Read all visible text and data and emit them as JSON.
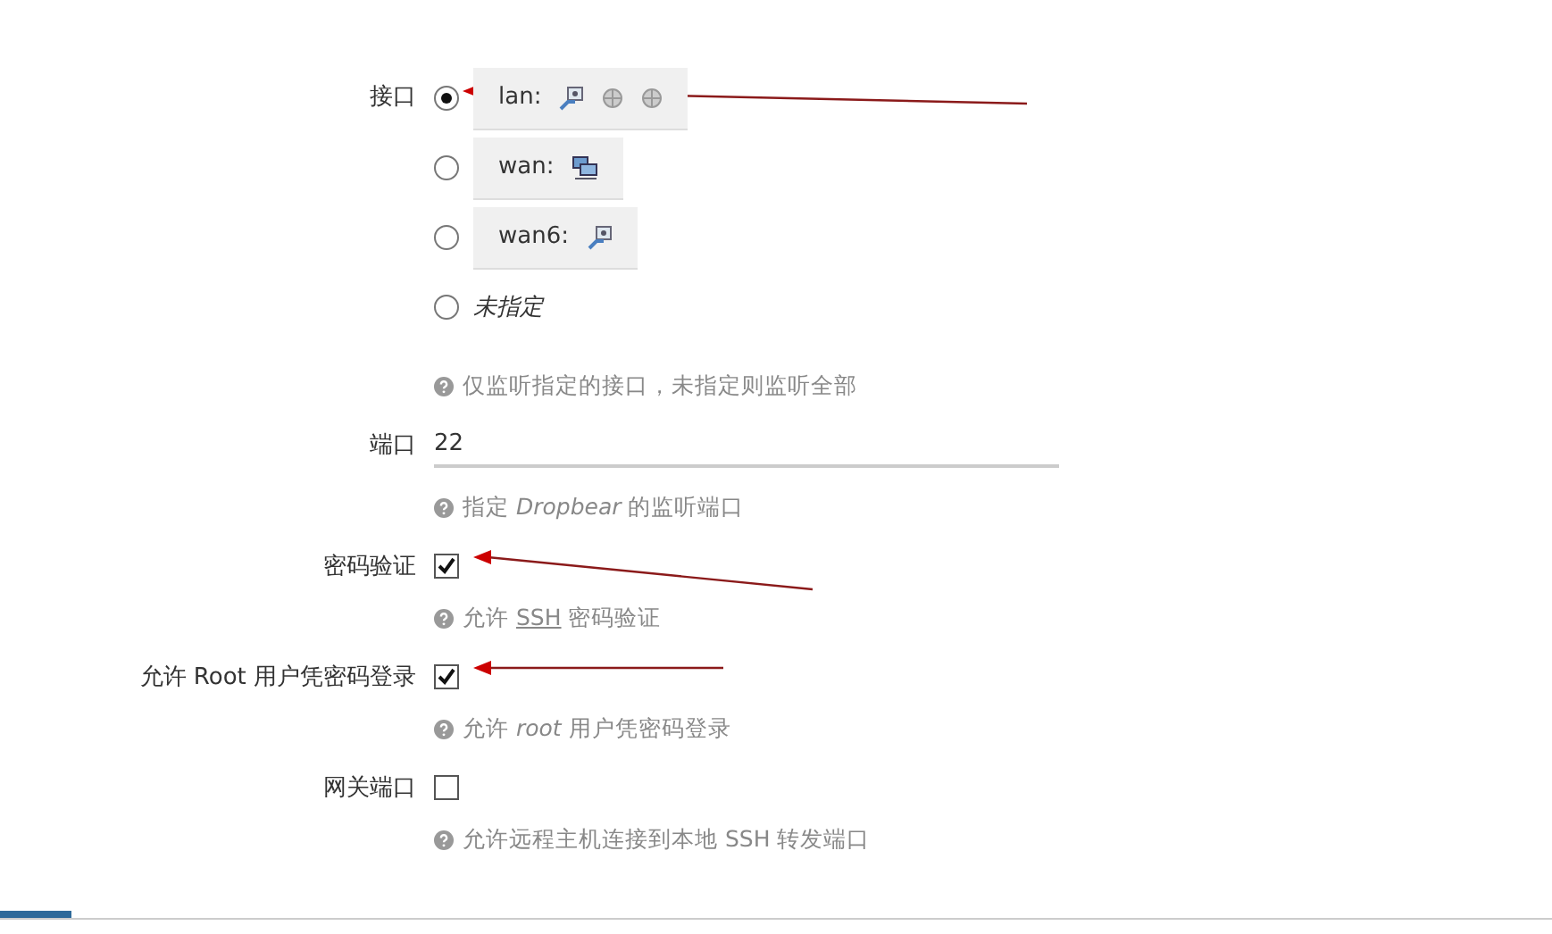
{
  "interface": {
    "label": "接口",
    "options": [
      {
        "name": "lan:",
        "kind": "bridge",
        "selected": true,
        "arrow": true
      },
      {
        "name": "wan:",
        "kind": "switch",
        "selected": false,
        "arrow": false
      },
      {
        "name": "wan6:",
        "kind": "alias",
        "selected": false,
        "arrow": false
      },
      {
        "name": "未指定",
        "kind": "none",
        "selected": false,
        "arrow": false
      }
    ],
    "hint": "仅监听指定的接口，未指定则监听全部"
  },
  "port": {
    "label": "端口",
    "value": "22",
    "hint": "指定 *Dropbear* 的监听端口"
  },
  "checks": [
    {
      "label": "密码验证",
      "checked": true,
      "arrow": true,
      "hint_parts": [
        "允许 ",
        "SSH",
        " 密码验证"
      ]
    },
    {
      "label": "允许 Root 用户凭密码登录",
      "checked": true,
      "arrow": true,
      "hint_parts": [
        "允许 *root* 用户凭密码登录"
      ]
    },
    {
      "label": "网关端口",
      "checked": false,
      "arrow": false,
      "hint_parts": [
        "允许远程主机连接到本地 SSH 转发端口"
      ]
    }
  ]
}
